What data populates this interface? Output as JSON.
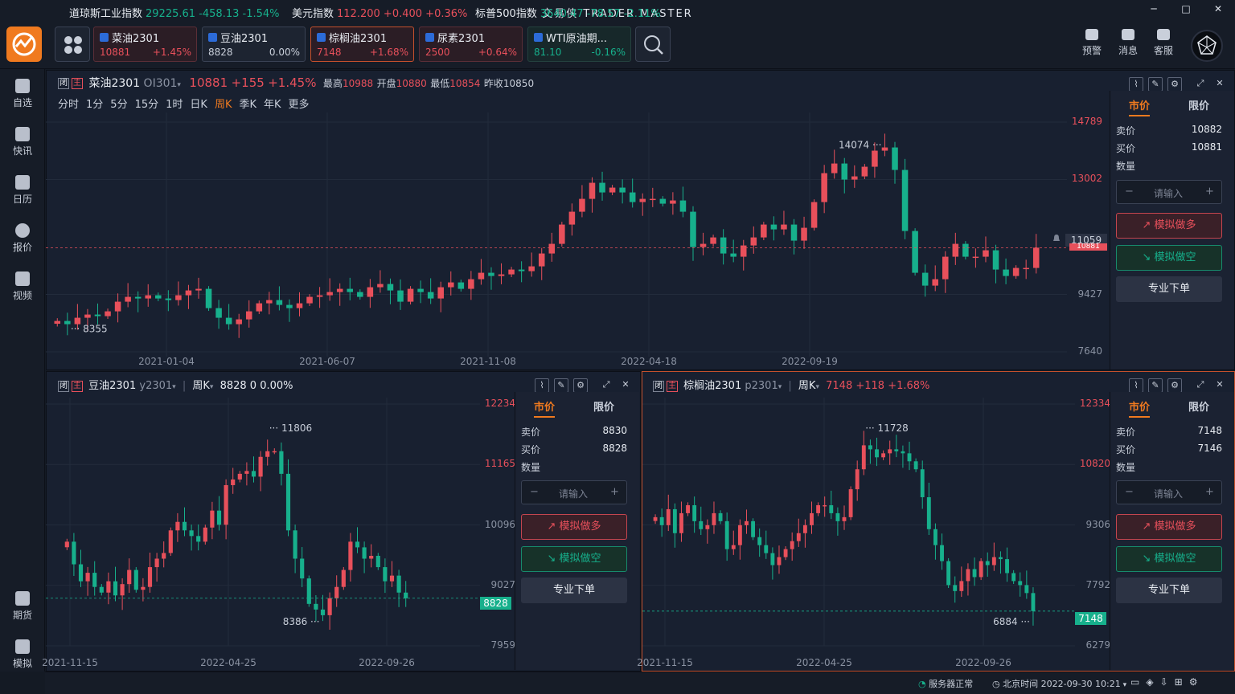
{
  "app": {
    "title": "交易侠 TRADER MASTER"
  },
  "window_controls": [
    "─",
    "□",
    "✕"
  ],
  "tickers": [
    {
      "name": "菜油2301",
      "price": "10881",
      "change": "+1.45%",
      "dir": "up"
    },
    {
      "name": "豆油2301",
      "price": "8828",
      "change": "0.00%",
      "dir": "flat"
    },
    {
      "name": "棕榈油2301",
      "price": "7148",
      "change": "+1.68%",
      "dir": "up"
    },
    {
      "name": "尿素2301",
      "price": "2500",
      "change": "+0.64%",
      "dir": "up"
    },
    {
      "name": "WTI原油期...",
      "price": "81.10",
      "change": "-0.16%",
      "dir": "dn"
    }
  ],
  "top_actions": [
    "预警",
    "消息",
    "客服"
  ],
  "sidebar": {
    "items": [
      "自选",
      "快讯",
      "日历",
      "报价",
      "视频"
    ],
    "bottom": [
      "期货",
      "模拟"
    ]
  },
  "main": {
    "tag1": "闭",
    "tag2": "主",
    "name": "菜油2301",
    "code": "OI301",
    "price": "10881",
    "chg": "+155",
    "pct": "+1.45%",
    "high_l": "最高",
    "high": "10988",
    "open_l": "开盘",
    "open": "10880",
    "low_l": "最低",
    "low": "10854",
    "prev_l": "昨收",
    "prev": "10850",
    "periods": [
      "分时",
      "1分",
      "5分",
      "15分",
      "1时",
      "日K",
      "周K",
      "季K",
      "年K",
      "更多"
    ],
    "active_period": "周K",
    "price_tag": "11059",
    "last_tag": "10881"
  },
  "soy": {
    "tag1": "闭",
    "tag2": "主",
    "name": "豆油2301",
    "code": "y2301",
    "period": "周K",
    "price": "8828",
    "chg": "0",
    "pct": "0.00%",
    "price_tag": "8828"
  },
  "palm": {
    "tag1": "闭",
    "tag2": "主",
    "name": "棕榈油2301",
    "code": "p2301",
    "period": "周K",
    "price": "7148",
    "chg": "+118",
    "pct": "+1.68%",
    "price_tag": "7148"
  },
  "trade_main": {
    "tab_market": "市价",
    "tab_limit": "限价",
    "sell_l": "卖价",
    "sell": "10882",
    "buy_l": "买价",
    "buy": "10881",
    "qty_l": "数量",
    "qty_ph": "请输入",
    "long": "模拟做多",
    "short": "模拟做空",
    "pro": "专业下单"
  },
  "trade_soy": {
    "tab_market": "市价",
    "tab_limit": "限价",
    "sell_l": "卖价",
    "sell": "8830",
    "buy_l": "买价",
    "buy": "8828",
    "qty_l": "数量",
    "qty_ph": "请输入",
    "long": "模拟做多",
    "short": "模拟做空",
    "pro": "专业下单"
  },
  "trade_palm": {
    "tab_market": "市价",
    "tab_limit": "限价",
    "sell_l": "卖价",
    "sell": "7148",
    "buy_l": "买价",
    "buy": "7146",
    "qty_l": "数量",
    "qty_ph": "请输入",
    "long": "模拟做多",
    "short": "模拟做空",
    "pro": "专业下单"
  },
  "bottom": {
    "indices": [
      {
        "name": "道琼斯工业指数",
        "value": "29225.61",
        "chg": "-458.13",
        "pct": "-1.54%",
        "dir": "dn"
      },
      {
        "name": "美元指数",
        "value": "112.200",
        "chg": "+0.400",
        "pct": "+0.36%",
        "dir": "up"
      },
      {
        "name": "标普500指数",
        "value": "3640.47",
        "chg": "-78.57",
        "pct": "-2.11%",
        "dir": "dn"
      }
    ],
    "server": "服务器正常",
    "time": "北京时间 2022-09-30 10:21"
  },
  "colors": {
    "up": "#e8505b",
    "down": "#17b08c",
    "accent": "#f07a1f"
  },
  "chart_data": [
    {
      "type": "candlestick",
      "title": "菜油2301 OI301 周K",
      "y_ticks": [
        "14789",
        "13002",
        "9427",
        "7640"
      ],
      "x_ticks": [
        "2021-01-04",
        "2021-06-07",
        "2021-11-08",
        "2022-04-18",
        "2022-09-19"
      ],
      "ylim": [
        7640,
        14789
      ],
      "annotations": [
        {
          "label": "14074",
          "value": 14074
        },
        {
          "label": "8355",
          "value": 8355
        }
      ],
      "close_series": [
        8600,
        8500,
        8700,
        8800,
        8750,
        8900,
        9200,
        9350,
        9300,
        9400,
        9300,
        9250,
        9400,
        9550,
        9600,
        9000,
        8700,
        8500,
        8650,
        8900,
        9150,
        9250,
        9100,
        9000,
        9150,
        9350,
        9400,
        9500,
        9600,
        9500,
        9350,
        9650,
        9750,
        9550,
        9200,
        9600,
        9500,
        9300,
        9650,
        9800,
        9600,
        9900,
        10100,
        10000,
        10050,
        10200,
        10150,
        10300,
        10700,
        11000,
        11600,
        12000,
        12400,
        12900,
        12600,
        12750,
        12600,
        12300,
        12400,
        12400,
        12250,
        12350,
        12000,
        10900,
        11000,
        11200,
        10700,
        10600,
        10950,
        11200,
        11600,
        11450,
        11600,
        11100,
        11500,
        12300,
        13200,
        13500,
        13000,
        13100,
        13400,
        13900,
        14000,
        13300,
        11400,
        10100,
        9700,
        9900,
        10600,
        11000,
        10600,
        10600,
        10800,
        10200,
        10000,
        10250,
        10250,
        10881
      ]
    },
    {
      "type": "candlestick",
      "title": "豆油2301 y2301 周K",
      "y_ticks": [
        "12234",
        "11165",
        "10096",
        "9027",
        "7959"
      ],
      "x_ticks": [
        "2021-11-15",
        "2022-04-25",
        "2022-09-26"
      ],
      "ylim": [
        7959,
        12234
      ],
      "annotations": [
        {
          "label": "11806",
          "value": 11806
        },
        {
          "label": "8386",
          "value": 8386
        }
      ],
      "close_series": [
        9800,
        9400,
        9100,
        9250,
        9000,
        8900,
        9100,
        8850,
        9050,
        9300,
        8950,
        9000,
        9350,
        9500,
        9600,
        10000,
        10150,
        10000,
        9900,
        9800,
        10050,
        10350,
        10100,
        10800,
        10900,
        11000,
        11050,
        10950,
        11300,
        11400,
        11400,
        11000,
        10000,
        9500,
        9150,
        8700,
        8600,
        8500,
        8800,
        9000,
        9300,
        9800,
        9700,
        9500,
        9550,
        9350,
        9100,
        9200,
        8900,
        8800
      ]
    },
    {
      "type": "candlestick",
      "title": "棕榈油2301 p2301 周K",
      "y_ticks": [
        "12334",
        "10820",
        "9306",
        "7792",
        "6279"
      ],
      "x_ticks": [
        "2021-11-15",
        "2022-04-25",
        "2022-09-26"
      ],
      "ylim": [
        6279,
        12334
      ],
      "annotations": [
        {
          "label": "11728",
          "value": 11728
        },
        {
          "label": "6884",
          "value": 6884
        }
      ],
      "close_series": [
        9500,
        9300,
        9700,
        9100,
        9600,
        9800,
        9400,
        9200,
        9300,
        9600,
        9400,
        8700,
        8800,
        9300,
        9400,
        9000,
        8800,
        8600,
        8300,
        8500,
        8700,
        8900,
        9100,
        9300,
        9600,
        9800,
        9800,
        9600,
        9400,
        9500,
        10200,
        10700,
        11300,
        11200,
        11000,
        11100,
        11200,
        11150,
        11100,
        10900,
        10700,
        10000,
        9200,
        8800,
        8400,
        7800,
        7650,
        7900,
        8200,
        8000,
        8400,
        8300,
        8500,
        8450,
        8100,
        7900,
        7800,
        7600,
        7148
      ]
    }
  ]
}
